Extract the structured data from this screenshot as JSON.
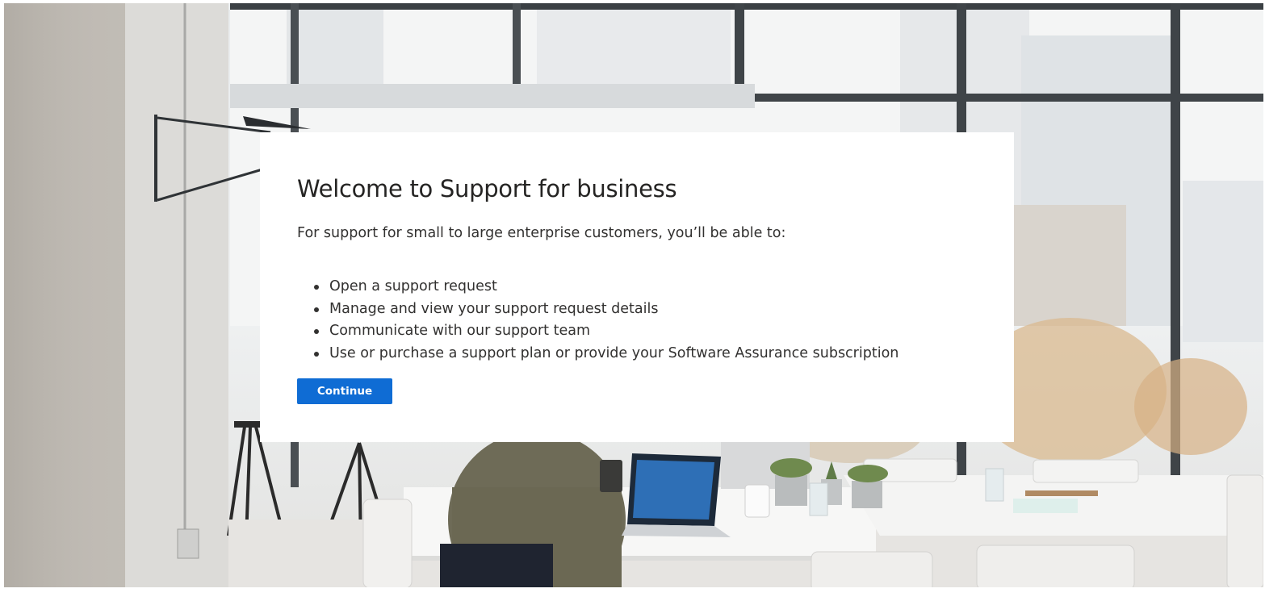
{
  "page": {
    "background_image": "office-meeting-room-photo"
  },
  "welcome": {
    "title": "Welcome to Support for business",
    "intro": "For support for small to large enterprise customers, you’ll be able to:",
    "items": [
      "Open a support request",
      "Manage and view your support request details",
      "Communicate with our support team",
      "Use or purchase a support plan or provide your Software Assurance subscription"
    ],
    "continue_label": "Continue"
  },
  "colors": {
    "accent": "#0f6cd4",
    "card_bg": "#ffffff",
    "text": "#323130"
  }
}
